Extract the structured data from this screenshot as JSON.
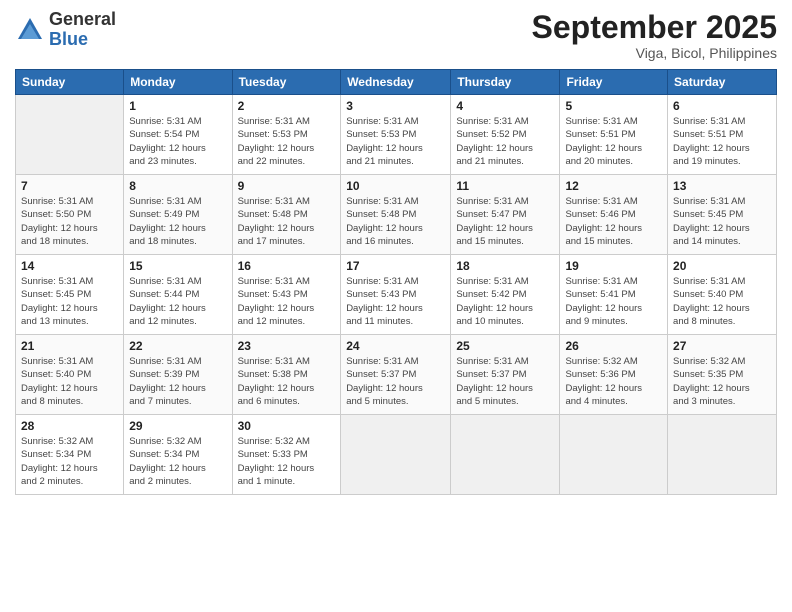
{
  "logo": {
    "general": "General",
    "blue": "Blue"
  },
  "title": "September 2025",
  "location": "Viga, Bicol, Philippines",
  "days_of_week": [
    "Sunday",
    "Monday",
    "Tuesday",
    "Wednesday",
    "Thursday",
    "Friday",
    "Saturday"
  ],
  "weeks": [
    [
      {
        "day": "",
        "info": ""
      },
      {
        "day": "1",
        "info": "Sunrise: 5:31 AM\nSunset: 5:54 PM\nDaylight: 12 hours\nand 23 minutes."
      },
      {
        "day": "2",
        "info": "Sunrise: 5:31 AM\nSunset: 5:53 PM\nDaylight: 12 hours\nand 22 minutes."
      },
      {
        "day": "3",
        "info": "Sunrise: 5:31 AM\nSunset: 5:53 PM\nDaylight: 12 hours\nand 21 minutes."
      },
      {
        "day": "4",
        "info": "Sunrise: 5:31 AM\nSunset: 5:52 PM\nDaylight: 12 hours\nand 21 minutes."
      },
      {
        "day": "5",
        "info": "Sunrise: 5:31 AM\nSunset: 5:51 PM\nDaylight: 12 hours\nand 20 minutes."
      },
      {
        "day": "6",
        "info": "Sunrise: 5:31 AM\nSunset: 5:51 PM\nDaylight: 12 hours\nand 19 minutes."
      }
    ],
    [
      {
        "day": "7",
        "info": "Sunrise: 5:31 AM\nSunset: 5:50 PM\nDaylight: 12 hours\nand 18 minutes."
      },
      {
        "day": "8",
        "info": "Sunrise: 5:31 AM\nSunset: 5:49 PM\nDaylight: 12 hours\nand 18 minutes."
      },
      {
        "day": "9",
        "info": "Sunrise: 5:31 AM\nSunset: 5:48 PM\nDaylight: 12 hours\nand 17 minutes."
      },
      {
        "day": "10",
        "info": "Sunrise: 5:31 AM\nSunset: 5:48 PM\nDaylight: 12 hours\nand 16 minutes."
      },
      {
        "day": "11",
        "info": "Sunrise: 5:31 AM\nSunset: 5:47 PM\nDaylight: 12 hours\nand 15 minutes."
      },
      {
        "day": "12",
        "info": "Sunrise: 5:31 AM\nSunset: 5:46 PM\nDaylight: 12 hours\nand 15 minutes."
      },
      {
        "day": "13",
        "info": "Sunrise: 5:31 AM\nSunset: 5:45 PM\nDaylight: 12 hours\nand 14 minutes."
      }
    ],
    [
      {
        "day": "14",
        "info": "Sunrise: 5:31 AM\nSunset: 5:45 PM\nDaylight: 12 hours\nand 13 minutes."
      },
      {
        "day": "15",
        "info": "Sunrise: 5:31 AM\nSunset: 5:44 PM\nDaylight: 12 hours\nand 12 minutes."
      },
      {
        "day": "16",
        "info": "Sunrise: 5:31 AM\nSunset: 5:43 PM\nDaylight: 12 hours\nand 12 minutes."
      },
      {
        "day": "17",
        "info": "Sunrise: 5:31 AM\nSunset: 5:43 PM\nDaylight: 12 hours\nand 11 minutes."
      },
      {
        "day": "18",
        "info": "Sunrise: 5:31 AM\nSunset: 5:42 PM\nDaylight: 12 hours\nand 10 minutes."
      },
      {
        "day": "19",
        "info": "Sunrise: 5:31 AM\nSunset: 5:41 PM\nDaylight: 12 hours\nand 9 minutes."
      },
      {
        "day": "20",
        "info": "Sunrise: 5:31 AM\nSunset: 5:40 PM\nDaylight: 12 hours\nand 8 minutes."
      }
    ],
    [
      {
        "day": "21",
        "info": "Sunrise: 5:31 AM\nSunset: 5:40 PM\nDaylight: 12 hours\nand 8 minutes."
      },
      {
        "day": "22",
        "info": "Sunrise: 5:31 AM\nSunset: 5:39 PM\nDaylight: 12 hours\nand 7 minutes."
      },
      {
        "day": "23",
        "info": "Sunrise: 5:31 AM\nSunset: 5:38 PM\nDaylight: 12 hours\nand 6 minutes."
      },
      {
        "day": "24",
        "info": "Sunrise: 5:31 AM\nSunset: 5:37 PM\nDaylight: 12 hours\nand 5 minutes."
      },
      {
        "day": "25",
        "info": "Sunrise: 5:31 AM\nSunset: 5:37 PM\nDaylight: 12 hours\nand 5 minutes."
      },
      {
        "day": "26",
        "info": "Sunrise: 5:32 AM\nSunset: 5:36 PM\nDaylight: 12 hours\nand 4 minutes."
      },
      {
        "day": "27",
        "info": "Sunrise: 5:32 AM\nSunset: 5:35 PM\nDaylight: 12 hours\nand 3 minutes."
      }
    ],
    [
      {
        "day": "28",
        "info": "Sunrise: 5:32 AM\nSunset: 5:34 PM\nDaylight: 12 hours\nand 2 minutes."
      },
      {
        "day": "29",
        "info": "Sunrise: 5:32 AM\nSunset: 5:34 PM\nDaylight: 12 hours\nand 2 minutes."
      },
      {
        "day": "30",
        "info": "Sunrise: 5:32 AM\nSunset: 5:33 PM\nDaylight: 12 hours\nand 1 minute."
      },
      {
        "day": "",
        "info": ""
      },
      {
        "day": "",
        "info": ""
      },
      {
        "day": "",
        "info": ""
      },
      {
        "day": "",
        "info": ""
      }
    ]
  ]
}
